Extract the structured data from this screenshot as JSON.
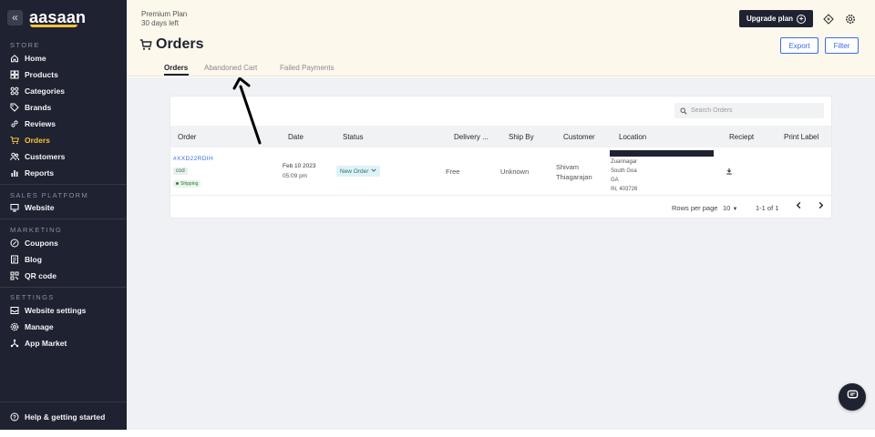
{
  "sidebar": {
    "collapse_glyph": "«",
    "logo": "aasaan",
    "sections": {
      "store": "STORE",
      "sales_platform": "SALES PLATFORM",
      "marketing": "MARKETING",
      "settings": "SETTINGS"
    },
    "items": {
      "home": "Home",
      "products": "Products",
      "categories": "Categories",
      "brands": "Brands",
      "reviews": "Reviews",
      "orders": "Orders",
      "customers": "Customers",
      "reports": "Reports",
      "website": "Website",
      "coupons": "Coupons",
      "blog": "Blog",
      "qr_code": "QR code",
      "website_settings": "Website settings",
      "manage": "Manage",
      "app_market": "App Market",
      "help": "Help & getting started"
    },
    "active_item": "orders",
    "accent_color": "#f6c23e"
  },
  "header": {
    "plan_name": "Premium Plan",
    "plan_days": "30 days left",
    "upgrade_label": "Upgrade plan",
    "page_title": "Orders",
    "export_label": "Export",
    "filter_label": "Filter",
    "tabs": [
      "Orders",
      "Abandoned Cart",
      "Failed Payments"
    ],
    "active_tab": "Orders"
  },
  "table": {
    "search_placeholder": "Search Orders",
    "columns": [
      "Order",
      "Date",
      "Status",
      "Delivery ...",
      "Ship By",
      "Customer",
      "Location",
      "Reciept",
      "Print Label"
    ],
    "rows": [
      {
        "order_id": "#XXD22RDIH",
        "payment_tag": "cod",
        "shipping_tag": "Shipping",
        "date": "Feb 10 2023",
        "time": "05:09 pm",
        "status": "New Order",
        "delivery": "Free",
        "ship_by": "Unknown",
        "customer_first": "Shivam",
        "customer_last": "Thiagarajan",
        "location_lines": [
          "Zuarinagar",
          "South Goa",
          "GA",
          "IN, 403726"
        ]
      }
    ],
    "rows_per_page_label": "Rows per page",
    "rows_per_page_value": "10",
    "range_label": "1-1 of 1"
  },
  "colors": {
    "sidebar_bg": "#1f2230",
    "header_bg": "#fdf8ec",
    "main_bg": "#eff1f4",
    "link_blue": "#3a6ee8"
  }
}
